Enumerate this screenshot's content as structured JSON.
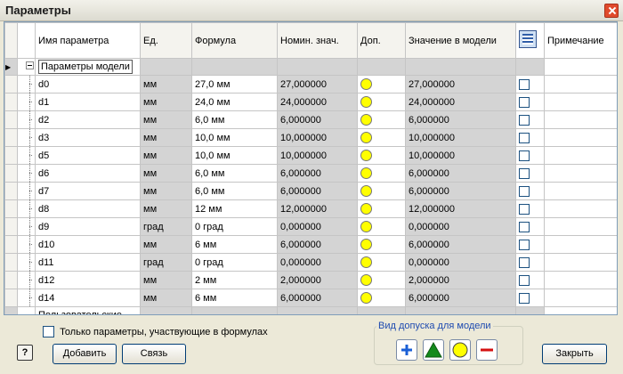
{
  "window": {
    "title": "Параметры"
  },
  "columns": {
    "name": "Имя параметра",
    "unit": "Ед.",
    "formula": "Формула",
    "nominal": "Номин. знач.",
    "tolerance": "Доп.",
    "model_value": "Значение в модели",
    "export_icon": "export-parameters-icon",
    "note": "Примечание"
  },
  "group": {
    "label": "Параметры модели"
  },
  "rows": [
    {
      "name": "d0",
      "unit": "мм",
      "formula": "27,0 мм",
      "nominal": "27,000000",
      "model": "27,000000"
    },
    {
      "name": "d1",
      "unit": "мм",
      "formula": "24,0 мм",
      "nominal": "24,000000",
      "model": "24,000000"
    },
    {
      "name": "d2",
      "unit": "мм",
      "formula": "6,0 мм",
      "nominal": "6,000000",
      "model": "6,000000"
    },
    {
      "name": "d3",
      "unit": "мм",
      "formula": "10,0 мм",
      "nominal": "10,000000",
      "model": "10,000000"
    },
    {
      "name": "d5",
      "unit": "мм",
      "formula": "10,0 мм",
      "nominal": "10,000000",
      "model": "10,000000"
    },
    {
      "name": "d6",
      "unit": "мм",
      "formula": "6,0 мм",
      "nominal": "6,000000",
      "model": "6,000000"
    },
    {
      "name": "d7",
      "unit": "мм",
      "formula": "6,0 мм",
      "nominal": "6,000000",
      "model": "6,000000"
    },
    {
      "name": "d8",
      "unit": "мм",
      "formula": "12 мм",
      "nominal": "12,000000",
      "model": "12,000000"
    },
    {
      "name": "d9",
      "unit": "град",
      "formula": "0 град",
      "nominal": "0,000000",
      "model": "0,000000"
    },
    {
      "name": "d10",
      "unit": "мм",
      "formula": "6 мм",
      "nominal": "6,000000",
      "model": "6,000000"
    },
    {
      "name": "d11",
      "unit": "град",
      "formula": "0 град",
      "nominal": "0,000000",
      "model": "0,000000"
    },
    {
      "name": "d12",
      "unit": "мм",
      "formula": "2 мм",
      "nominal": "2,000000",
      "model": "2,000000"
    },
    {
      "name": "d14",
      "unit": "мм",
      "formula": "6 мм",
      "nominal": "6,000000",
      "model": "6,000000"
    }
  ],
  "user_group": {
    "label": "Пользовательские"
  },
  "filter": {
    "label": "Только параметры, участвующие в формулах",
    "checked": false
  },
  "tolerance_group": {
    "legend": "Вид допуска для модели",
    "buttons": [
      "upper-tolerance-icon",
      "lower-tolerance-icon",
      "nominal-tolerance-icon",
      "lower-limit-icon"
    ]
  },
  "buttons": {
    "help": "?",
    "add": "Добавить",
    "link": "Связь",
    "close": "Закрыть"
  },
  "colors": {
    "tolerance_dot": "#ffff00",
    "plus": "#1a5fd6",
    "triangle": "#138a1c",
    "minus": "#d41111"
  }
}
